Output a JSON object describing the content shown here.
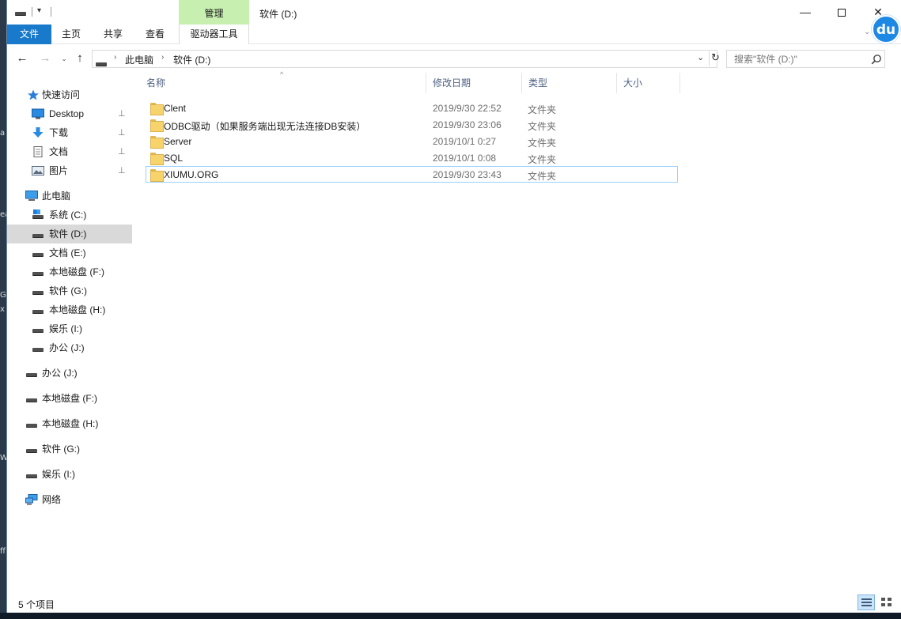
{
  "window": {
    "title": "软件 (D:)",
    "contextual_tab": "管理",
    "minimize": "—",
    "maximize": "",
    "close": "✕"
  },
  "ribbon": {
    "tabs": [
      "文件",
      "主页",
      "共享",
      "查看",
      "驱动器工具"
    ],
    "expand": "⌄"
  },
  "baidu_badge": "du",
  "address": {
    "breadcrumb": [
      "此电脑",
      "软件 (D:)"
    ],
    "separator": "›",
    "dropdown": "⌄",
    "refresh": "↻"
  },
  "search": {
    "placeholder": "搜索\"软件 (D:)\""
  },
  "nav": {
    "back": "←",
    "forward": "→",
    "recent": "⌄",
    "up": "↑"
  },
  "sidebar": {
    "pin": "📌",
    "items": [
      {
        "label": "快速访问",
        "icon": "star-icon"
      },
      {
        "label": "Desktop",
        "icon": "desktop-icon",
        "pinned": true
      },
      {
        "label": "下载",
        "icon": "download-icon",
        "pinned": true
      },
      {
        "label": "文档",
        "icon": "document-icon",
        "pinned": true
      },
      {
        "label": "图片",
        "icon": "picture-icon",
        "pinned": true
      },
      {
        "label": "此电脑",
        "icon": "computer-icon"
      },
      {
        "label": "系统 (C:)",
        "icon": "system-drive-icon"
      },
      {
        "label": "软件 (D:)",
        "icon": "drive-icon",
        "selected": true
      },
      {
        "label": "文档 (E:)",
        "icon": "drive-icon"
      },
      {
        "label": "本地磁盘 (F:)",
        "icon": "drive-icon"
      },
      {
        "label": "软件 (G:)",
        "icon": "drive-icon"
      },
      {
        "label": "本地磁盘 (H:)",
        "icon": "drive-icon"
      },
      {
        "label": "娱乐 (I:)",
        "icon": "drive-icon"
      },
      {
        "label": "办公 (J:)",
        "icon": "drive-icon"
      },
      {
        "label": "办公 (J:)",
        "icon": "drive-icon"
      },
      {
        "label": "本地磁盘 (F:)",
        "icon": "drive-icon"
      },
      {
        "label": "本地磁盘 (H:)",
        "icon": "drive-icon"
      },
      {
        "label": "软件 (G:)",
        "icon": "drive-icon"
      },
      {
        "label": "娱乐 (I:)",
        "icon": "drive-icon"
      },
      {
        "label": "网络",
        "icon": "network-icon"
      }
    ]
  },
  "columns": {
    "name": "名称",
    "modified": "修改日期",
    "type": "类型",
    "size": "大小",
    "sort_indicator": "^"
  },
  "files": [
    {
      "name": "Clent",
      "modified": "2019/9/30 22:52",
      "type": "文件夹"
    },
    {
      "name": "ODBC驱动（如果服务端出现无法连接DB安装）",
      "modified": "2019/9/30 23:06",
      "type": "文件夹"
    },
    {
      "name": "Server",
      "modified": "2019/10/1 0:27",
      "type": "文件夹"
    },
    {
      "name": "SQL",
      "modified": "2019/10/1 0:08",
      "type": "文件夹"
    },
    {
      "name": "XIUMU.ORG",
      "modified": "2019/9/30 23:43",
      "type": "文件夹",
      "focused": true
    }
  ],
  "status": {
    "item_count": "5 个项目"
  },
  "desktop_fragments": [
    "a",
    "ea",
    "G",
    "x",
    "W",
    "ff"
  ],
  "colors": {
    "file_tab": "#1979ca",
    "manage_tab": "#c6efb0",
    "selected_nav": "#d9d9d9",
    "column_header_text": "#4d6082",
    "focus_border": "#99d1ff"
  }
}
